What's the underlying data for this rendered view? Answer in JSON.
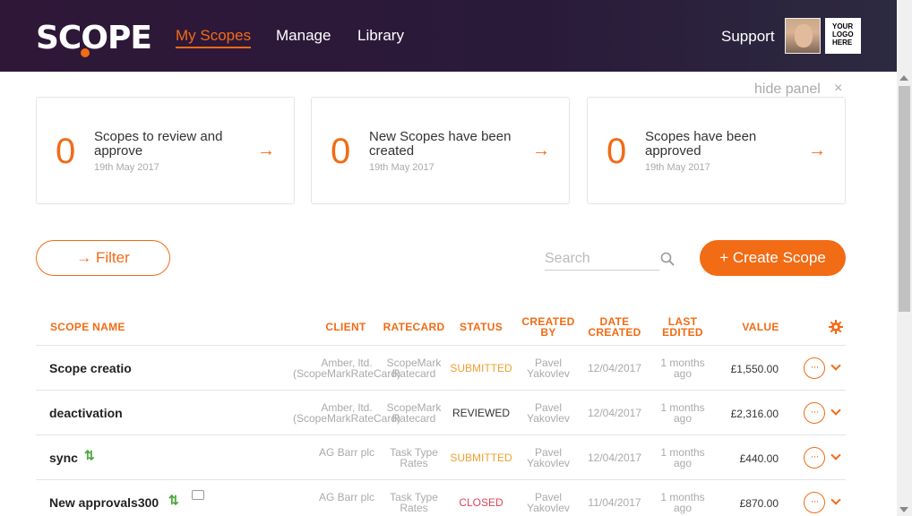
{
  "header": {
    "logo": "SCOPE",
    "nav": [
      "My Scopes",
      "Manage",
      "Library"
    ],
    "support": "Support",
    "logo_placeholder": [
      "YOUR",
      "LOGO",
      "HERE"
    ]
  },
  "panel": {
    "hide_label": "hide panel",
    "close": "×",
    "cards": [
      {
        "count": "0",
        "text": "Scopes to review and approve",
        "date": "19th May 2017",
        "arrow": "→"
      },
      {
        "count": "0",
        "text": "New Scopes have been created",
        "date": "19th May 2017",
        "arrow": "→"
      },
      {
        "count": "0",
        "text": "Scopes have been approved",
        "date": "19th May 2017",
        "arrow": "→"
      }
    ]
  },
  "toolbar": {
    "filter_label": "→ Filter",
    "search_placeholder": "Search",
    "create_label": "+ Create Scope"
  },
  "table": {
    "headers": [
      "SCOPE NAME",
      "CLIENT",
      "RATECARD",
      "STATUS",
      "CREATED BY",
      "DATE CREATED",
      "LAST EDITED",
      "VALUE"
    ],
    "rows": [
      {
        "name": "Scope creatio",
        "client": "Amber, ltd. (ScopeMarkRateCard)",
        "ratecard": "ScopeMark Ratecard",
        "status": "SUBMITTED",
        "created_by": "Pavel Yakovlev",
        "date": "12/04/2017",
        "edited": "1 months ago",
        "value": "£1,550.00",
        "dots": "···"
      },
      {
        "name": "deactivation",
        "client": "Amber, ltd. (ScopeMarkRateCard)",
        "ratecard": "ScopeMark Ratecard",
        "status": "REVIEWED",
        "created_by": "Pavel Yakovlev",
        "date": "12/04/2017",
        "edited": "1 months ago",
        "value": "£2,316.00",
        "dots": "···"
      },
      {
        "name": "sync",
        "client": "AG Barr plc",
        "ratecard": "Task Type Rates",
        "status": "SUBMITTED",
        "created_by": "Pavel Yakovlev",
        "date": "12/04/2017",
        "edited": "1 months ago",
        "value": "£440.00",
        "dots": "···"
      },
      {
        "name": "New approvals300",
        "client": "AG Barr plc",
        "ratecard": "Task Type Rates",
        "status": "CLOSED",
        "created_by": "Pavel Yakovlev",
        "date": "11/04/2017",
        "edited": "1 months ago",
        "value": "£870.00",
        "dots": "···"
      }
    ]
  },
  "colors": {
    "accent": "#f26b15",
    "submitted": "#f0a030",
    "reviewed": "#333333",
    "closed": "#e0435a",
    "sync_icon": "#49a83b"
  },
  "icons": [
    "search-icon",
    "gear-icon",
    "sort-arrows-icon",
    "comment-icon",
    "chevron-down-icon",
    "more-dots-icon",
    "close-icon",
    "arrow-right-icon"
  ]
}
